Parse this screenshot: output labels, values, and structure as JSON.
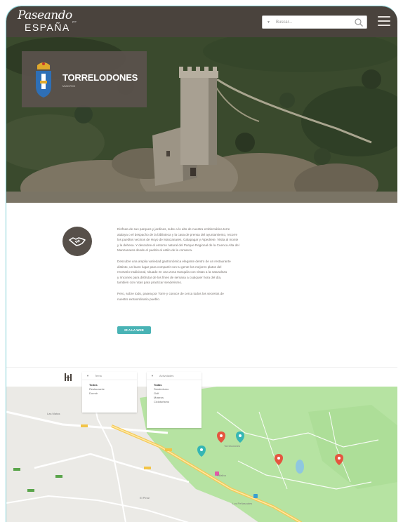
{
  "header": {
    "logo_script": "Paseando",
    "logo_suffix": "por",
    "logo_country": "ESPAÑA",
    "search_placeholder": "Buscar...",
    "search_caret": "▼",
    "menu_icon": "hamburger-icon"
  },
  "hero": {
    "town_name": "TORRELODONES",
    "province": "MADRID"
  },
  "content": {
    "icon": "handshake-icon",
    "paragraphs": [
      [
        "Disfruta de sus parques y jardines, sube a lo alto de nuestra emblemática torre",
        "atalaya o el despacho de la biblioteca y la casa de prensa del ayuntamiento, recorre",
        "los pueblos vecinos de Hoyo de Manzanares, Galapagar y Alpedrete. Visita al monte",
        "y la dehesa. Y descubre el entorno natural del Parque Regional de la Cuenca Alta del",
        "Manzanares desde el pueblo al estilo de la comarca."
      ],
      [
        "Descubre una amplia variedad gastronómica elegante dentro de un restaurante",
        "distinto, un buen lugar para compartir con tu gente los mejores platos del",
        "recetario tradicional, situado en una zona tranquila con vistas a la naturaleza",
        "y rincones para disfrutar de los fines de semana a cualquier hora del día,",
        "también con rutas para practicar senderismo."
      ],
      [
        "Pero, sobre todo, pasea por Torre y conoce de cerca todos los secretos de",
        "nuestro extraordinario pueblo."
      ]
    ],
    "cta_label": "IR A LA WEB"
  },
  "filters": {
    "dropdown1": {
      "caret": "▼",
      "label": "Tema",
      "options": [
        "Todos",
        "Restaurante",
        "Dormir"
      ],
      "selected": "Todos"
    },
    "dropdown2": {
      "caret": "▼",
      "label": "Actividades",
      "options": [
        "Todas",
        "Senderismo",
        "Golf",
        "Museos",
        "Cicloturismo"
      ],
      "selected": "Todas"
    }
  },
  "map": {
    "labels": [
      "Las Matas",
      "El Pinar",
      "Torrelodones",
      "Villalba",
      "Los Peñascales"
    ]
  },
  "colors": {
    "header": "#4a433d",
    "accent": "#49b3b5",
    "marker_red": "#e5553f",
    "marker_teal": "#36b6b4",
    "park_green": "#b6e3a2"
  }
}
